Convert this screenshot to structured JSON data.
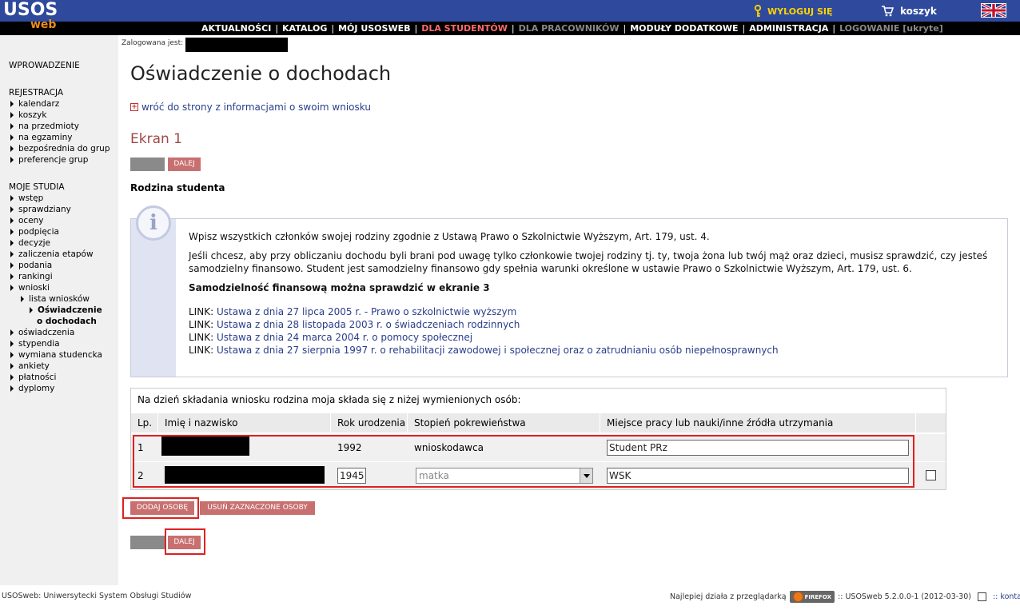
{
  "header": {
    "logo_main": "USOS",
    "logo_sub": "web",
    "logout": "WYLOGUJ SIĘ",
    "cart": "koszyk"
  },
  "nav": [
    {
      "label": "AKTUALNOŚCI",
      "state": "normal"
    },
    {
      "label": "KATALOG",
      "state": "normal"
    },
    {
      "label": "MÓJ USOSWEB",
      "state": "normal"
    },
    {
      "label": "DLA STUDENTÓW",
      "state": "active"
    },
    {
      "label": "DLA PRACOWNIKÓW",
      "state": "dim"
    },
    {
      "label": "MODUŁY DODATKOWE",
      "state": "normal"
    },
    {
      "label": "ADMINISTRACJA",
      "state": "normal"
    },
    {
      "label": "LOGOWANIE [ukryte]",
      "state": "dim"
    }
  ],
  "logged_as": "Zalogowana jest:",
  "sidebar": {
    "intro": "WPROWADZENIE",
    "registration": "REJESTRACJA",
    "registration_items": [
      "kalendarz",
      "koszyk",
      "na przedmioty",
      "na egzaminy",
      "bezpośrednia do grup",
      "preferencje grup"
    ],
    "studies": "MOJE STUDIA",
    "studies_items_a": [
      "wstęp",
      "sprawdziany",
      "oceny",
      "podpięcia",
      "decyzje",
      "zaliczenia etapów",
      "podania",
      "rankingi",
      "wnioski"
    ],
    "sub_item": "lista wniosków",
    "current_item_line1": "Oświadczenie",
    "current_item_line2": "o dochodach",
    "studies_items_b": [
      "oświadczenia",
      "stypendia",
      "wymiana studencka",
      "ankiety",
      "płatności",
      "dyplomy"
    ]
  },
  "main": {
    "title": "Oświadczenie o dochodach",
    "back_link": "wróć do strony z informacjami o swoim wniosku",
    "screen_title": "Ekran 1",
    "next_label": "DALEJ",
    "family_title": "Rodzina studenta",
    "info_p1": "Wpisz wszystkich członków swojej rodziny zgodnie z Ustawą Prawo o Szkolnictwie Wyższym, Art. 179, ust. 4.",
    "info_p2": "Jeśli chcesz, aby przy obliczaniu dochodu byli brani pod uwagę tylko członkowie twojej rodziny tj. ty, twoja żona lub twój mąż oraz dzieci, musisz sprawdzić, czy jesteś samodzielny finansowo. Student jest samodzielny finansowo gdy spełnia warunki określone w ustawie Prawo o Szkolnictwie Wyższym, Art. 179, ust. 6.",
    "info_bold": "Samodzielność finansową można sprawdzić w ekranie 3",
    "link_prefix": "LINK:",
    "links": [
      "Ustawa z dnia 27 lipca 2005 r. - Prawo o szkolnictwie wyższym",
      "Ustawa z dnia 28 listopada 2003 r. o świadczeniach rodzinnych",
      "Ustawa z dnia 24 marca 2004 r. o pomocy społecznej",
      "Ustawa z dnia 27 sierpnia 1997 r. o rehabilitacji zawodowej i społecznej oraz o zatrudnianiu osób niepełnosprawnych"
    ],
    "table_caption": "Na dzień składania wniosku rodzina moja składa się z niżej wymienionych osób:",
    "columns": [
      "Lp.",
      "Imię i nazwisko",
      "Rok urodzenia",
      "Stopień pokrewieństwa",
      "Miejsce pracy lub nauki/inne źródła utrzymania"
    ],
    "rows": [
      {
        "lp": "1",
        "year": "1992",
        "relation": "wnioskodawca",
        "workplace": "Student PRz"
      },
      {
        "lp": "2",
        "year": "1945",
        "relation": "matka",
        "workplace": "WSK"
      }
    ],
    "add_person": "DODAJ OSOBĘ",
    "remove_persons": "USUŃ ZAZNACZONE OSOBY"
  },
  "footer": {
    "left": "USOSweb: Uniwersytecki System Obsługi Studiów",
    "best_with": "Najlepiej działa z przeglądarką",
    "browser": "FIREFOX",
    "version": ":: USOSweb 5.2.0.0-1 (2012-03-30)",
    "contact": ":: kontakt"
  }
}
